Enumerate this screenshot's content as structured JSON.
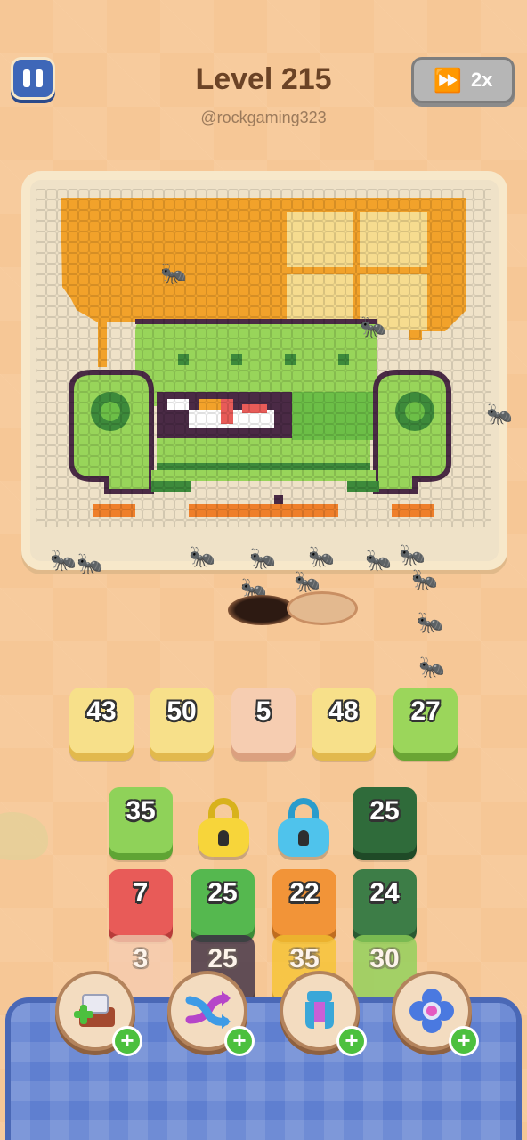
{
  "header": {
    "level_title": "Level 215",
    "username": "@rockgaming323",
    "speed_label": "2x"
  },
  "conveyor_tiles": [
    {
      "value": "43",
      "color": "#f7e08a",
      "shadow": "#e2b94d"
    },
    {
      "value": "50",
      "color": "#f7e08a",
      "shadow": "#e2b94d"
    },
    {
      "value": "5",
      "color": "#f6cdb1",
      "shadow": "#dba07f"
    },
    {
      "value": "48",
      "color": "#f7e08a",
      "shadow": "#e2b94d"
    },
    {
      "value": "27",
      "color": "#9bd65b",
      "shadow": "#6aa534"
    }
  ],
  "grid": {
    "row1": [
      {
        "value": "35",
        "color": "#8fd259",
        "shadow": "#5fa434"
      },
      {
        "value": "25",
        "color": "#2f6b3a",
        "shadow": "#1f4a27"
      }
    ],
    "row2": [
      {
        "value": "7",
        "color": "#e85b58",
        "shadow": "#b73c3a"
      },
      {
        "value": "25",
        "color": "#55b84f",
        "shadow": "#3b8b37"
      },
      {
        "value": "22",
        "color": "#f29438",
        "shadow": "#c06d1f"
      },
      {
        "value": "24",
        "color": "#3d7d47",
        "shadow": "#2a5a32"
      }
    ],
    "row3": [
      {
        "value": "3",
        "color": "#f6cdb1",
        "shadow": "#dba07f"
      },
      {
        "value": "25",
        "color": "#3d2f45",
        "shadow": "#271d2d"
      },
      {
        "value": "35",
        "color": "#f7c432",
        "shadow": "#d09a16"
      },
      {
        "value": "30",
        "color": "#8fd259",
        "shadow": "#5fa434"
      }
    ],
    "locks": [
      {
        "name": "yellow-lock",
        "color": "#f7d53a",
        "shackle": "#d8b21c"
      },
      {
        "name": "blue-lock",
        "color": "#4fc3ec",
        "shackle": "#2a9ccc"
      }
    ]
  },
  "boosters": [
    {
      "icon": "add-tray-icon"
    },
    {
      "icon": "shuffle-icon"
    },
    {
      "icon": "magnet-icon"
    },
    {
      "icon": "flower-icon"
    }
  ],
  "colors": {
    "wall": "#f2a22a",
    "window": "#f6dc8f",
    "sofa_light": "#98d55a",
    "sofa_dark": "#3d8a3b",
    "sofa_outline": "#4a2a45",
    "legs": "#ef7f2a",
    "accent_blue": "#3e67b8"
  }
}
